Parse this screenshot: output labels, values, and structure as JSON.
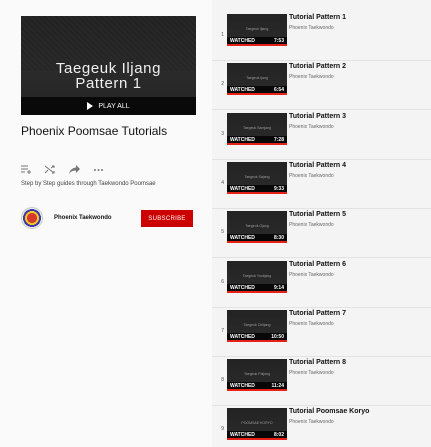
{
  "playlist": {
    "hero_title_line1": "Taegeuk Iljang",
    "hero_title_line2": "Pattern 1",
    "play_all_label": "PLAY ALL",
    "title": "Phoenix Poomsae Tutorials",
    "description": "Step by Step guides through Taekwondo Poomsae",
    "owner": "Phoenix Taekwondo",
    "subscribe_label": "SUBSCRIBE",
    "actions": [
      "add-to-queue-icon",
      "shuffle-icon",
      "share-icon",
      "more-icon"
    ]
  },
  "colors": {
    "accent": "#cc0000",
    "progress": "#e62117",
    "thumb_bg": "#232323"
  },
  "videos": [
    {
      "index": "1",
      "title": "Tutorial Pattern 1",
      "channel": "Phoenix Taekwondo",
      "thumb_text": "Taegeuk Iljang",
      "status": "WATCHED",
      "duration": "7:53"
    },
    {
      "index": "2",
      "title": "Tutorial Pattern 2",
      "channel": "Phoenix Taekwondo",
      "thumb_text": "Taegeuk Ijang",
      "status": "WATCHED",
      "duration": "6:54"
    },
    {
      "index": "3",
      "title": "Tutorial Pattern 3",
      "channel": "Phoenix Taekwondo",
      "thumb_text": "Taegeuk Samjang",
      "status": "WATCHED",
      "duration": "7:28"
    },
    {
      "index": "4",
      "title": "Tutorial Pattern 4",
      "channel": "Phoenix Taekwondo",
      "thumb_text": "Taegeuk Sajang",
      "status": "WATCHED",
      "duration": "9:33"
    },
    {
      "index": "5",
      "title": "Tutorial Pattern 5",
      "channel": "Phoenix Taekwondo",
      "thumb_text": "Taegeuk Ojang",
      "status": "WATCHED",
      "duration": "8:30"
    },
    {
      "index": "6",
      "title": "Tutorial Pattern 6",
      "channel": "Phoenix Taekwondo",
      "thumb_text": "Taegeuk Yookjang",
      "status": "WATCHED",
      "duration": "9:14"
    },
    {
      "index": "7",
      "title": "Tutorial Pattern 7",
      "channel": "Phoenix Taekwondo",
      "thumb_text": "Taegeuk Chiljang",
      "status": "WATCHED",
      "duration": "10:50"
    },
    {
      "index": "8",
      "title": "Tutorial Pattern 8",
      "channel": "Phoenix Taekwondo",
      "thumb_text": "Taegeuk Paljang",
      "status": "WATCHED",
      "duration": "11:24"
    },
    {
      "index": "9",
      "title": "Tutorial Poomsae Koryo",
      "channel": "Phoenix Taekwondo",
      "thumb_text": "POOMSAE KORYO",
      "status": "WATCHED",
      "duration": "8:02"
    }
  ]
}
